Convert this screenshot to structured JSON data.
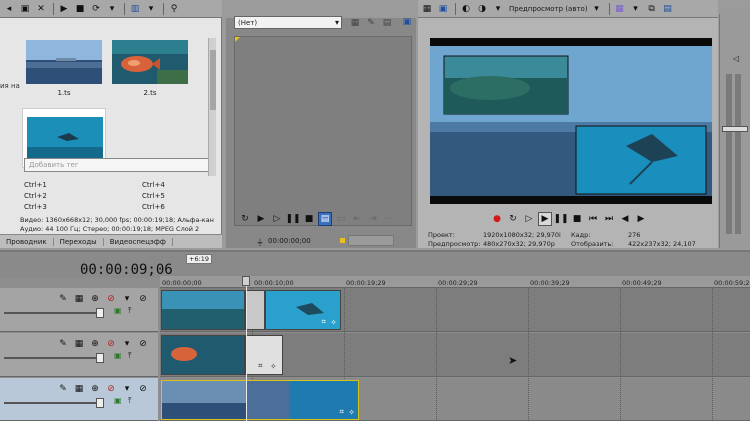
{
  "media": {
    "thumbs": [
      {
        "label": "1.ts"
      },
      {
        "label": "2.ts"
      }
    ],
    "search_placeholder": "Добавить тег",
    "shortcuts_left": [
      "Ctrl+1",
      "Ctrl+2",
      "Ctrl+3"
    ],
    "shortcuts_right": [
      "Ctrl+4",
      "Ctrl+5",
      "Ctrl+6"
    ],
    "info_video": "Видео: 1360x668x12; 30,000 fps; 00:00:19;18; Альфа-кан",
    "info_audio": "Аудио: 44 100 Гц; Стерео; 00:00:19;18; MPEG Слой 2",
    "side_label": "ия на"
  },
  "tabs": [
    "Проводник",
    "Переходы",
    "Видеоспецэфф"
  ],
  "trimmer": {
    "dropdown_value": "(Нет)",
    "timecode": "00:00:00;00"
  },
  "preview": {
    "mode_label": "Предпросмотр (авто)",
    "project_label": "Проект:",
    "project_value": "1920x1080x32; 29,970i",
    "preview_label": "Предпросмотр:",
    "preview_value": "480x270x32; 29,970p",
    "frame_label": "Кадр:",
    "frame_value": "276",
    "display_label": "Отобразить:",
    "display_value": "422x237x32; 24,107"
  },
  "timeline": {
    "current_time": "00:00:09;06",
    "marker_value": "+6:19",
    "ruler": [
      "00:00:00;00",
      "00:00:10;00",
      "00:00:19;29",
      "00:00:29;29",
      "00:00:39;29",
      "00:00:49;29",
      "00:00:59;28"
    ]
  },
  "colors": {
    "accent": "#3b7fd4",
    "record": "#d21a1a",
    "selection": "#b8c8d8"
  }
}
